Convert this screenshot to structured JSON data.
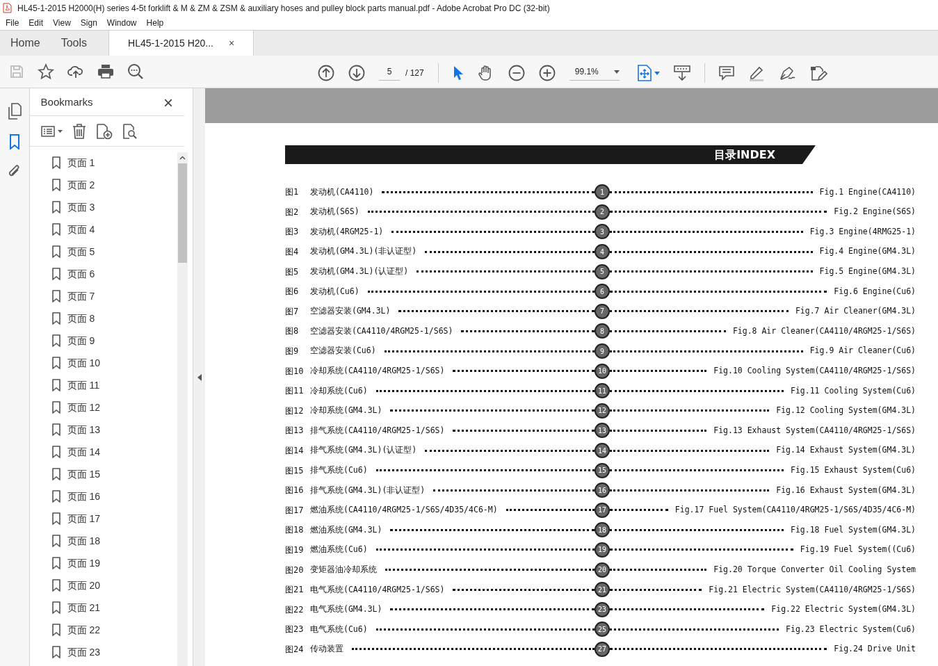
{
  "window": {
    "title": "HL45-1-2015 H2000(H) series 4-5t forklift & M & ZM & ZSM & auxiliary hoses and pulley block parts manual.pdf - Adobe Acrobat Pro DC (32-bit)"
  },
  "menu": [
    "File",
    "Edit",
    "View",
    "Sign",
    "Window",
    "Help"
  ],
  "tabs": [
    {
      "label": "Home",
      "selected": false
    },
    {
      "label": "Tools",
      "selected": false
    },
    {
      "label": "HL45-1-2015 H20...",
      "selected": true,
      "close": "×"
    }
  ],
  "toolbar": {
    "page": "5",
    "page_total": "/ 127",
    "zoom": "99.1%"
  },
  "bookmarks": {
    "title": "Bookmarks",
    "close": "×",
    "items": [
      "页面 1",
      "页面 2",
      "页面 3",
      "页面 4",
      "页面 5",
      "页面 6",
      "页面 7",
      "页面 8",
      "页面 9",
      "页面 10",
      "页面 11",
      "页面 12",
      "页面 13",
      "页面 14",
      "页面 15",
      "页面 16",
      "页面 17",
      "页面 18",
      "页面 19",
      "页面 20",
      "页面 21",
      "页面 22",
      "页面 23"
    ]
  },
  "document": {
    "heading": "目录INDEX",
    "entries": [
      {
        "fig": "图1",
        "title": "发动机(CA4110)",
        "badge": "1",
        "english": "Fig.1 Engine(CA4110)"
      },
      {
        "fig": "图2",
        "title": "发动机(S6S)",
        "badge": "2",
        "english": "Fig.2 Engine(S6S)"
      },
      {
        "fig": "图3",
        "title": "发动机(4RGM25-1)",
        "badge": "3",
        "english": "Fig.3 Engine(4RMG25-1)"
      },
      {
        "fig": "图4",
        "title": "发动机(GM4.3L)(非认证型)",
        "badge": "4",
        "english": "Fig.4 Engine(GM4.3L)"
      },
      {
        "fig": "图5",
        "title": "发动机(GM4.3L)(认证型)",
        "badge": "5",
        "english": "Fig.5 Engine(GM4.3L)"
      },
      {
        "fig": "图6",
        "title": "发动机(Cu6)",
        "badge": "6",
        "english": "Fig.6 Engine(Cu6)"
      },
      {
        "fig": "图7",
        "title": "空滤器安装(GM4.3L)",
        "badge": "7",
        "english": "Fig.7 Air Cleaner(GM4.3L)"
      },
      {
        "fig": "图8",
        "title": "空滤器安装(CA4110/4RGM25-1/S6S)",
        "badge": "8",
        "english": "Fig.8 Air Cleaner(CA4110/4RGM25-1/S6S)"
      },
      {
        "fig": "图9",
        "title": "空滤器安装(Cu6)",
        "badge": "9",
        "english": "Fig.9 Air Cleaner(Cu6)"
      },
      {
        "fig": "图10",
        "title": "冷却系统(CA4110/4RGM25-1/S6S)",
        "badge": "10",
        "english": "Fig.10 Cooling System(CA4110/4RGM25-1/S6S)"
      },
      {
        "fig": "图11",
        "title": "冷却系统(Cu6)",
        "badge": "11",
        "english": "Fig.11 Cooling System(Cu6)"
      },
      {
        "fig": "图12",
        "title": "冷却系统(GM4.3L)",
        "badge": "12",
        "english": "Fig.12 Cooling System(GM4.3L)"
      },
      {
        "fig": "图13",
        "title": "排气系统(CA4110/4RGM25-1/S6S)",
        "badge": "13",
        "english": "Fig.13 Exhaust System(CA4110/4RGM25-1/S6S)"
      },
      {
        "fig": "图14",
        "title": "排气系统(GM4.3L)(认证型)",
        "badge": "14",
        "english": "Fig.14 Exhaust System(GM4.3L)"
      },
      {
        "fig": "图15",
        "title": "排气系统(Cu6)",
        "badge": "15",
        "english": "Fig.15 Exhaust System(Cu6)"
      },
      {
        "fig": "图16",
        "title": "排气系统(GM4.3L)(非认证型)",
        "badge": "16",
        "english": "Fig.16 Exhaust System(GM4.3L)"
      },
      {
        "fig": "图17",
        "title": "燃油系统(CA4110/4RGM25-1/S6S/4D35/4C6-M)",
        "badge": "17",
        "english": "Fig.17 Fuel System(CA4110/4RGM25-1/S6S/4D35/4C6-M)"
      },
      {
        "fig": "图18",
        "title": "燃油系统(GM4.3L)",
        "badge": "18",
        "english": "Fig.18 Fuel System(GM4.3L)"
      },
      {
        "fig": "图19",
        "title": "燃油系统(Cu6)",
        "badge": "19",
        "english": "Fig.19 Fuel System((Cu6)"
      },
      {
        "fig": "图20",
        "title": "变矩器油冷却系统",
        "badge": "20",
        "english": "Fig.20 Torque Converter Oil Cooling System"
      },
      {
        "fig": "图21",
        "title": "电气系统(CA4110/4RGM25-1/S6S)",
        "badge": "21",
        "english": "Fig.21 Electric System(CA4110/4RGM25-1/S6S)"
      },
      {
        "fig": "图22",
        "title": "电气系统(GM4.3L)",
        "badge": "23",
        "english": "Fig.22 Electric System(GM4.3L)"
      },
      {
        "fig": "图23",
        "title": "电气系统(Cu6)",
        "badge": "25",
        "english": "Fig.23 Electric System(Cu6)"
      },
      {
        "fig": "图24",
        "title": "传动装置",
        "badge": "27",
        "english": "Fig.24 Drive Unit"
      }
    ]
  }
}
